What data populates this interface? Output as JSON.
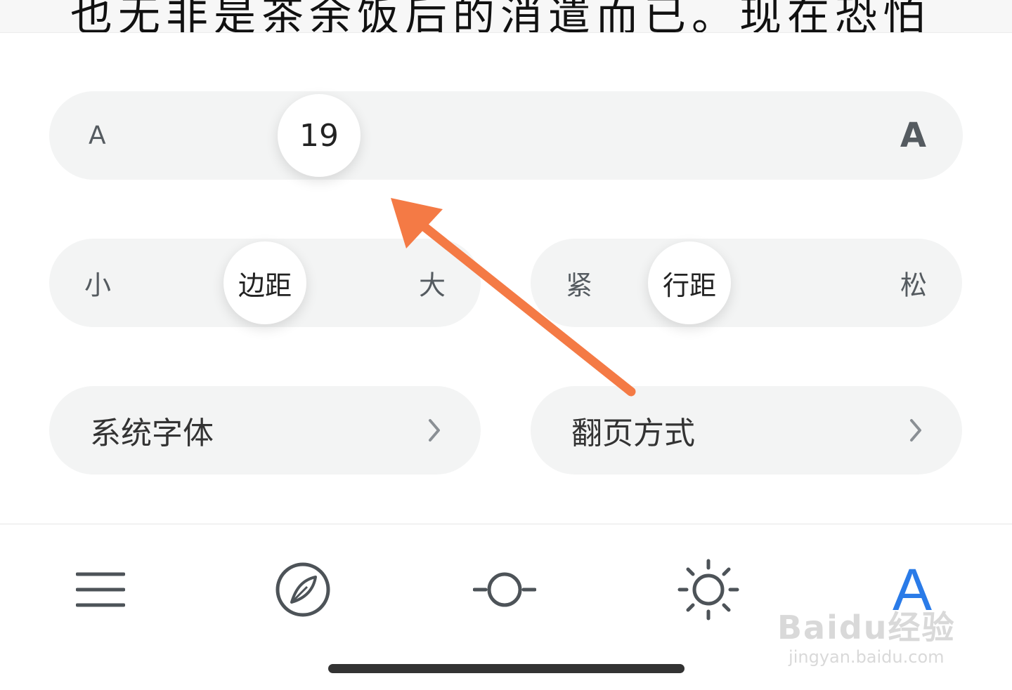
{
  "reader": {
    "text": "也无非是茶余饭后的消遣而已。现在恐怕"
  },
  "font_size_slider": {
    "small_label": "A",
    "value": "19",
    "large_label": "A"
  },
  "margin_slider": {
    "min_label": "小",
    "thumb_label": "边距",
    "max_label": "大"
  },
  "line_spacing_slider": {
    "min_label": "紧",
    "thumb_label": "行距",
    "max_label": "松"
  },
  "buttons": {
    "font": "系统字体",
    "page_turn": "翻页方式"
  },
  "toolbar": {
    "active_label": "A",
    "icons": [
      "menu-icon",
      "compass-icon",
      "progress-icon",
      "brightness-icon",
      "font-icon"
    ],
    "active_color": "#2a7be8"
  },
  "annotation": {
    "arrow_color": "#f47a45"
  },
  "watermark": {
    "logo": "Baidu经验",
    "url": "jingyan.baidu.com"
  }
}
